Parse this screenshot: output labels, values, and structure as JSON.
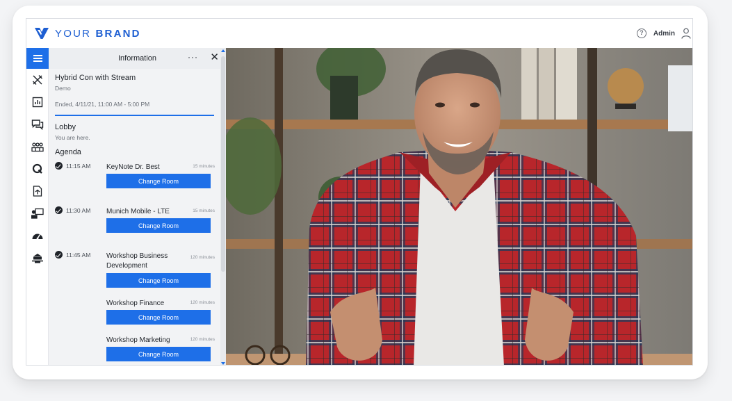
{
  "brand": {
    "name_light": "YOUR",
    "name_bold": "BRAND",
    "color": "#1e5fd2",
    "logo_icon": "brand-v-logo"
  },
  "topbar": {
    "help_icon": "help-icon",
    "user_label": "Admin",
    "user_icon": "user-icon"
  },
  "rail": {
    "accent": "#1e6fe8",
    "items": [
      {
        "name": "menu-icon",
        "active": true
      },
      {
        "name": "tools-icon"
      },
      {
        "name": "chart-icon"
      },
      {
        "name": "chat-icon"
      },
      {
        "name": "people-icon"
      },
      {
        "name": "qa-icon"
      },
      {
        "name": "document-icon"
      },
      {
        "name": "presenter-icon"
      },
      {
        "name": "dashboard-icon"
      },
      {
        "name": "booth-icon"
      }
    ]
  },
  "panel": {
    "title": "Information",
    "more_label": "···",
    "close_label": "✕",
    "event": {
      "title": "Hybrid Con with Stream",
      "subtitle": "Demo",
      "dates": "Ended, 4/11/21, 11:00 AM - 5:00 PM"
    },
    "lobby": {
      "title": "Lobby",
      "subtitle": "You are here."
    },
    "agenda": {
      "title": "Agenda",
      "items": [
        {
          "time": "11:15 AM",
          "title": "KeyNote Dr. Best",
          "duration": "15 minutes",
          "button": "Change Room",
          "done": true
        },
        {
          "time": "11:30 AM",
          "title": "Munich Mobile - LTE",
          "duration": "15 minutes",
          "button": "Change Room",
          "done": true
        },
        {
          "time": "11:45 AM",
          "title": "Workshop Business Development",
          "duration": "120 minutes",
          "button": "Change Room",
          "done": true
        },
        {
          "time": "",
          "title": "Workshop Finance",
          "duration": "120 minutes",
          "button": "Change Room",
          "done": false
        },
        {
          "time": "",
          "title": "Workshop Marketing",
          "duration": "120 minutes",
          "button": "Change Room",
          "done": false
        }
      ]
    }
  },
  "video": {
    "content": "speaker-video-stream"
  }
}
